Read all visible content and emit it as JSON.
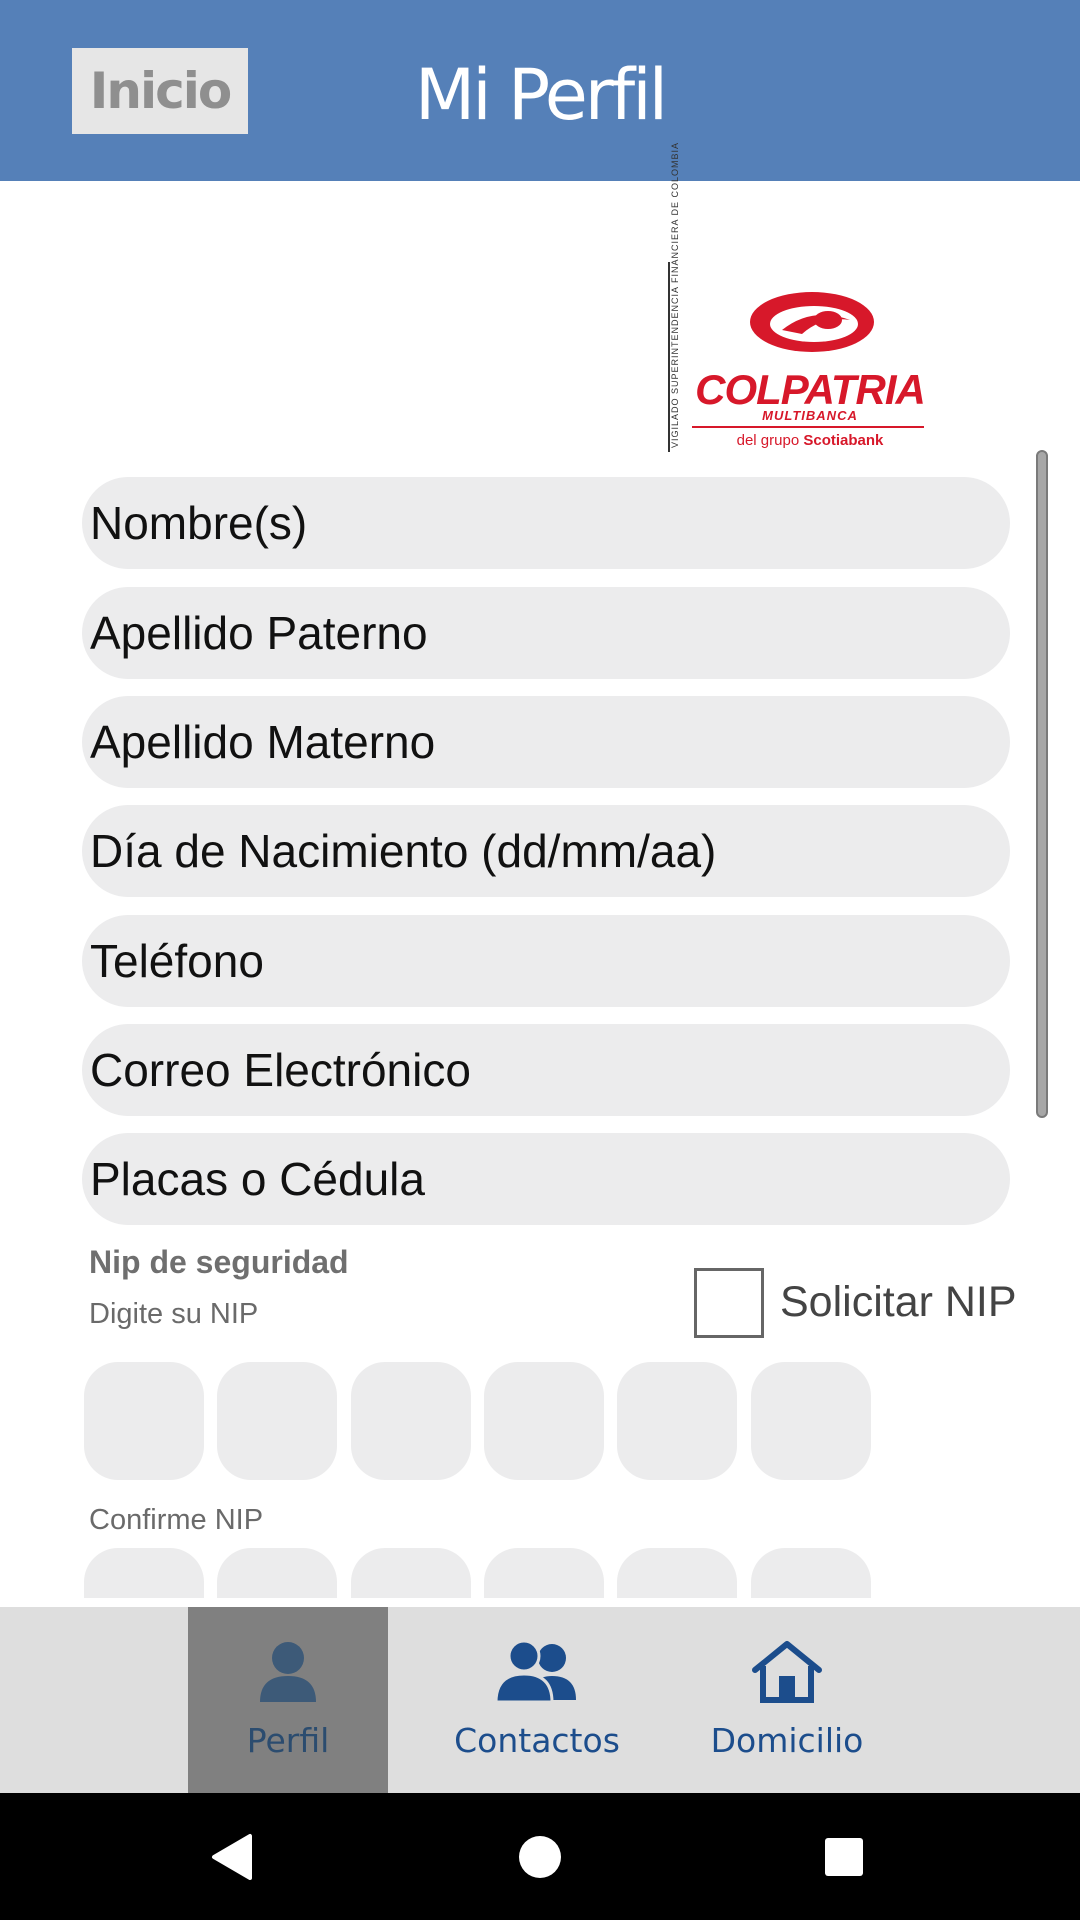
{
  "header": {
    "back_label": "Inicio",
    "title": "Mi Perfil"
  },
  "logo": {
    "vigilado": "VIGILADO SUPERINTENDENCIA FINANCIERA DE COLOMBIA",
    "brand": "COLPATRIA",
    "sub": "MULTIBANCA",
    "group_prefix": "del grupo",
    "group_brand": "Scotiabank"
  },
  "form": {
    "fields": [
      {
        "placeholder": "Nombre(s)"
      },
      {
        "placeholder": "Apellido Paterno"
      },
      {
        "placeholder": "Apellido Materno"
      },
      {
        "placeholder": "Día de Nacimiento (dd/mm/aa)"
      },
      {
        "placeholder": "Teléfono"
      },
      {
        "placeholder": "Correo Electrónico"
      },
      {
        "placeholder": "Placas o Cédula"
      }
    ],
    "nip_title": "Nip de seguridad",
    "nip_label": "Digite su NIP",
    "solicitar_label": "Solicitar NIP",
    "confirm_label": "Confirme NIP"
  },
  "bottom_nav": {
    "items": [
      {
        "label": "Perfil",
        "icon": "person-icon",
        "active": true
      },
      {
        "label": "Contactos",
        "icon": "people-icon",
        "active": false
      },
      {
        "label": "Domicilio",
        "icon": "home-icon",
        "active": false
      }
    ]
  },
  "colors": {
    "header": "#5580b8",
    "brand_red": "#d7182a",
    "nav_blue": "#1c4d8c"
  }
}
